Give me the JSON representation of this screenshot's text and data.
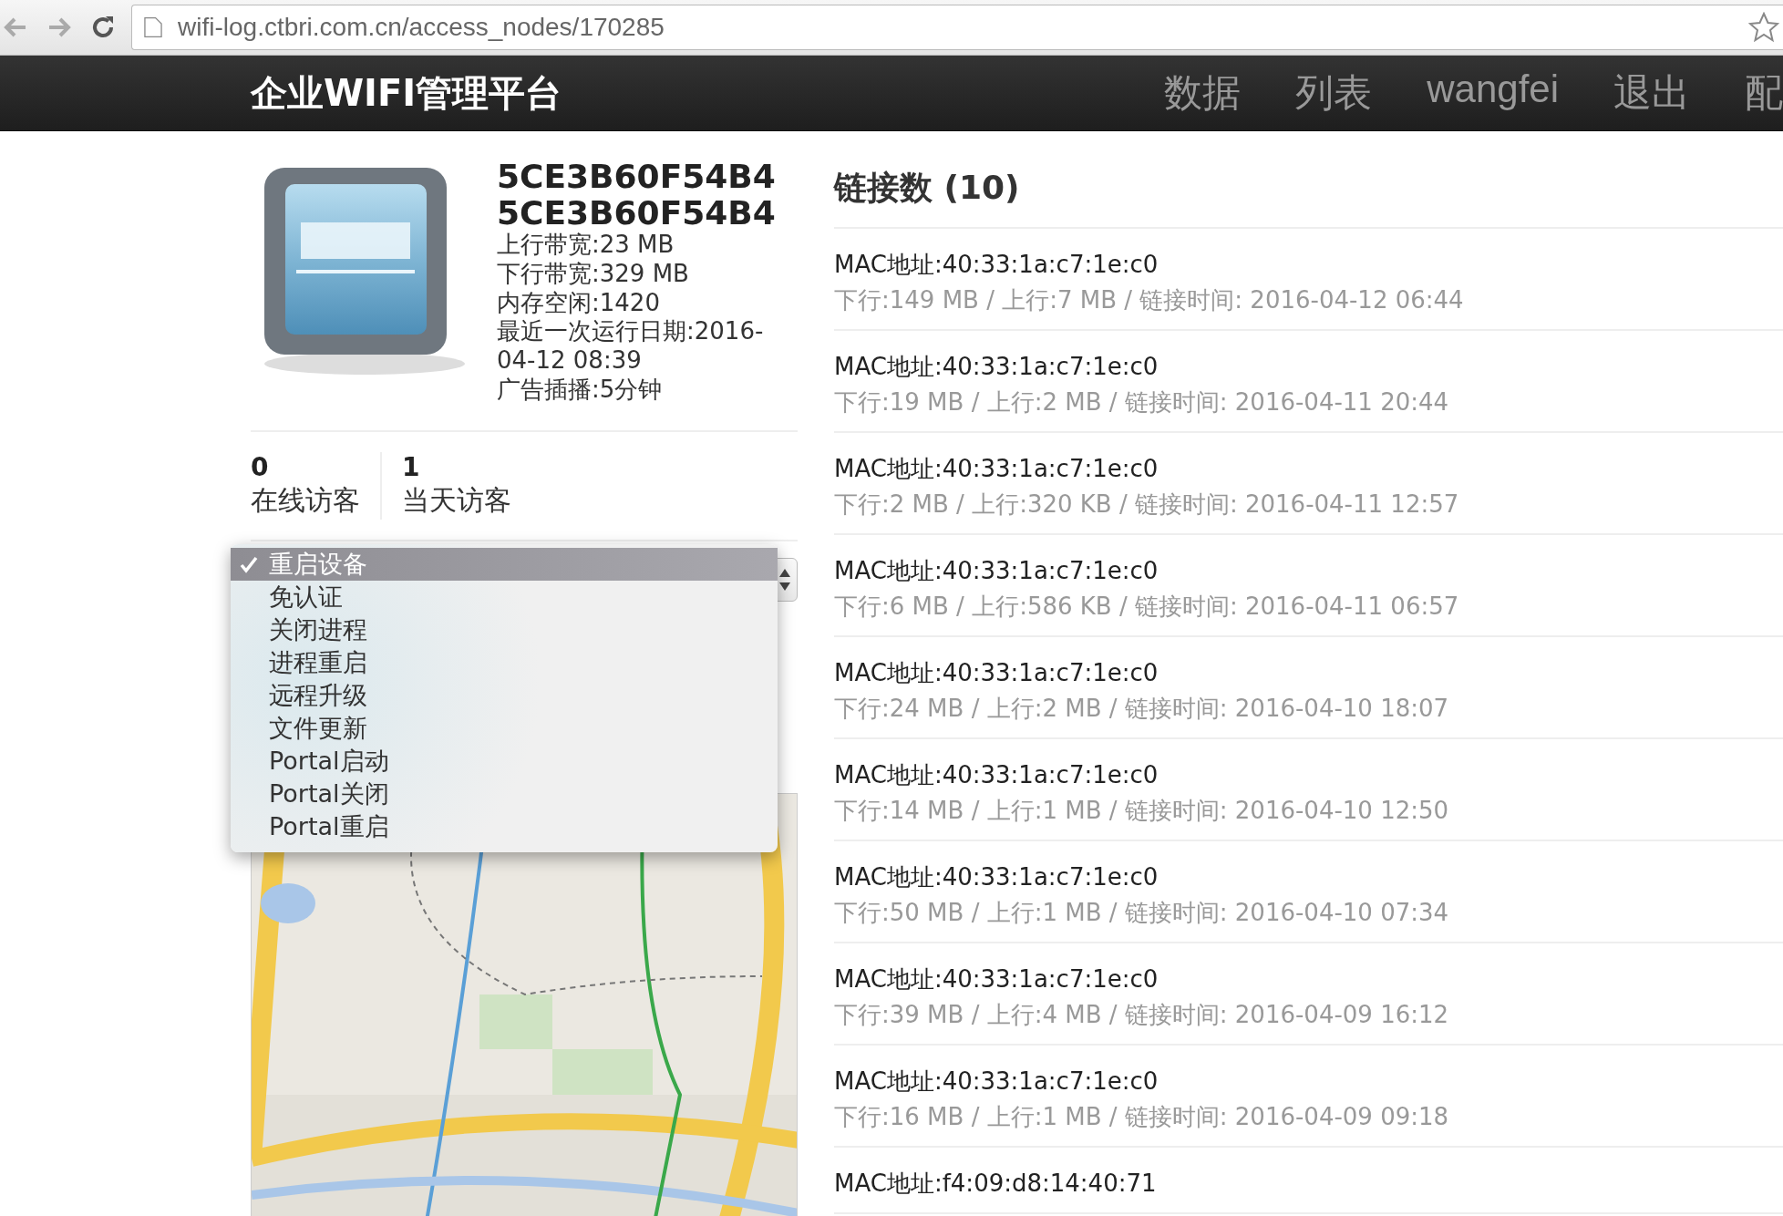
{
  "browser": {
    "url": "wifi-log.ctbri.com.cn/access_nodes/170285"
  },
  "nav": {
    "brand": "企业WIFI管理平台",
    "items": [
      "数据",
      "列表",
      "wangfei",
      "退出",
      "配"
    ]
  },
  "device": {
    "names": [
      "5CE3B60F54B4",
      "5CE3B60F54B4"
    ],
    "details": [
      "上行带宽:23 MB",
      "下行带宽:329 MB",
      "内存空闲:1420",
      "最近一次运行日期:2016-04-12 08:39",
      "广告插播:5分钟"
    ],
    "stats": [
      {
        "value": "0",
        "label": "在线访客"
      },
      {
        "value": "1",
        "label": "当天访客"
      }
    ]
  },
  "command_select": {
    "options": [
      {
        "label": "重启设备",
        "selected": true
      },
      {
        "label": "免认证",
        "selected": false
      },
      {
        "label": "关闭进程",
        "selected": false
      },
      {
        "label": "进程重启",
        "selected": false
      },
      {
        "label": "远程升级",
        "selected": false
      },
      {
        "label": "文件更新",
        "selected": false
      },
      {
        "label": "Portal启动",
        "selected": false
      },
      {
        "label": "Portal关闭",
        "selected": false
      },
      {
        "label": "Portal重启",
        "selected": false
      }
    ]
  },
  "connections": {
    "title": "链接数 (10)",
    "items": [
      {
        "mac": "MAC地址:40:33:1a:c7:1e:c0",
        "detail": "下行:149 MB / 上行:7 MB / 链接时间: 2016-04-12 06:44"
      },
      {
        "mac": "MAC地址:40:33:1a:c7:1e:c0",
        "detail": "下行:19 MB / 上行:2 MB / 链接时间: 2016-04-11 20:44"
      },
      {
        "mac": "MAC地址:40:33:1a:c7:1e:c0",
        "detail": "下行:2 MB / 上行:320 KB / 链接时间: 2016-04-11 12:57"
      },
      {
        "mac": "MAC地址:40:33:1a:c7:1e:c0",
        "detail": "下行:6 MB / 上行:586 KB / 链接时间: 2016-04-11 06:57"
      },
      {
        "mac": "MAC地址:40:33:1a:c7:1e:c0",
        "detail": "下行:24 MB / 上行:2 MB / 链接时间: 2016-04-10 18:07"
      },
      {
        "mac": "MAC地址:40:33:1a:c7:1e:c0",
        "detail": "下行:14 MB / 上行:1 MB / 链接时间: 2016-04-10 12:50"
      },
      {
        "mac": "MAC地址:40:33:1a:c7:1e:c0",
        "detail": "下行:50 MB / 上行:1 MB / 链接时间: 2016-04-10 07:34"
      },
      {
        "mac": "MAC地址:40:33:1a:c7:1e:c0",
        "detail": "下行:39 MB / 上行:4 MB / 链接时间: 2016-04-09 16:12"
      },
      {
        "mac": "MAC地址:40:33:1a:c7:1e:c0",
        "detail": "下行:16 MB / 上行:1 MB / 链接时间: 2016-04-09 09:18"
      },
      {
        "mac": "MAC地址:f4:09:d8:14:40:71"
      }
    ]
  }
}
